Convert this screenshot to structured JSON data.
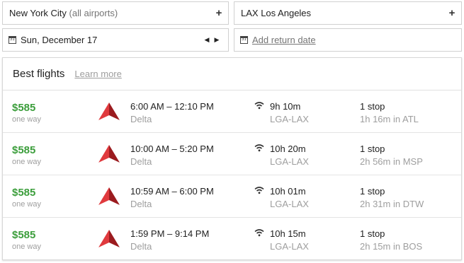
{
  "search": {
    "origin_city": "New York City",
    "origin_note": "(all airports)",
    "destination_code": "LAX",
    "destination_city": "Los Angeles",
    "depart_date": "Sun, December 17",
    "return_placeholder": "Add return date",
    "calendar_glyph": "31",
    "plus_glyph": "+",
    "prev_glyph": "◀",
    "next_glyph": "▶"
  },
  "results": {
    "title": "Best flights",
    "learn_more": "Learn more",
    "flights": [
      {
        "price": "$585",
        "price_note": "one way",
        "times": "6:00 AM – 12:10 PM",
        "airline": "Delta",
        "duration": "9h 10m",
        "route": "LGA-LAX",
        "stops": "1 stop",
        "layover": "1h 16m in ATL"
      },
      {
        "price": "$585",
        "price_note": "one way",
        "times": "10:00 AM – 5:20 PM",
        "airline": "Delta",
        "duration": "10h 20m",
        "route": "LGA-LAX",
        "stops": "1 stop",
        "layover": "2h 56m in MSP"
      },
      {
        "price": "$585",
        "price_note": "one way",
        "times": "10:59 AM – 6:00 PM",
        "airline": "Delta",
        "duration": "10h 01m",
        "route": "LGA-LAX",
        "stops": "1 stop",
        "layover": "2h 31m in DTW"
      },
      {
        "price": "$585",
        "price_note": "one way",
        "times": "1:59 PM – 9:14 PM",
        "airline": "Delta",
        "duration": "10h 15m",
        "route": "LGA-LAX",
        "stops": "1 stop",
        "layover": "2h 15m in BOS"
      }
    ]
  },
  "colors": {
    "price": "#3c9e3c",
    "delta_red_light": "#e03a3e",
    "delta_red_dark": "#9b1b1f",
    "muted_text": "#9e9e9e"
  },
  "icons": {
    "airline_logo": "delta-widget-icon",
    "wifi": "wifi-icon",
    "calendar": "calendar-icon",
    "add": "plus-icon",
    "prev": "chevron-left-icon",
    "next": "chevron-right-icon"
  }
}
